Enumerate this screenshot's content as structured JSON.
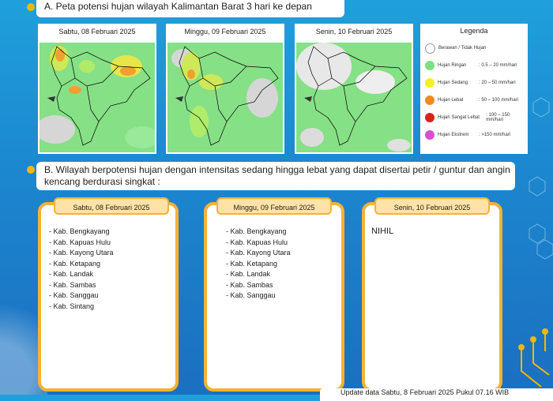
{
  "section_a": {
    "title": "A. Peta potensi hujan wilayah Kalimantan Barat 3 hari ke depan"
  },
  "maps": [
    {
      "date": "Sabtu, 08 Februari 2025"
    },
    {
      "date": "Minggu, 09 Februari 2025"
    },
    {
      "date": "Senin, 10 Februari 2025"
    }
  ],
  "legend": {
    "title": "Legenda",
    "items": [
      {
        "name": "Berawan / Tidak Hujan",
        "range": "",
        "color": "#ffffff"
      },
      {
        "name": "Hujan Ringan",
        "range": ": 0.5 – 20 mm/hari",
        "color": "#7ee07e"
      },
      {
        "name": "Hujan Sedang",
        "range": ": 20 – 50 mm/hari",
        "color": "#f4f21c"
      },
      {
        "name": "Hujan Lebat",
        "range": ": 50 – 100 mm/hari",
        "color": "#f08a24"
      },
      {
        "name": "Hujan Sangat Lebat",
        "range": ": 100 – 150 mm/hari",
        "color": "#e0201c"
      },
      {
        "name": "Hujan Ekstrem",
        "range": ": >150 mm/hari",
        "color": "#d94fd0"
      }
    ]
  },
  "section_b": {
    "title": "B. Wilayah berpotensi hujan dengan intensitas sedang hingga lebat yang dapat disertai petir / guntur dan angin kencang berdurasi singkat :"
  },
  "days": [
    {
      "date": "Sabtu, 08 Februari 2025",
      "regions": [
        "- Kab. Bengkayang",
        "- Kab. Kapuas Hulu",
        "- Kab. Kayong Utara",
        "- Kab. Ketapang",
        "- Kab. Landak",
        "- Kab. Sambas",
        "- Kab. Sanggau",
        "- Kab. Sintang"
      ]
    },
    {
      "date": "Minggu, 09 Februari 2025",
      "regions": [
        "- Kab. Bengkayang",
        "- Kab. Kapuas Hulu",
        "- Kab. Kayong Utara",
        "- Kab. Ketapang",
        "- Kab. Landak",
        "- Kab. Sambas",
        "- Kab. Sanggau"
      ]
    },
    {
      "date": "Senin, 10 Februari 2025",
      "text": "NIHIL"
    }
  ],
  "update_text": "Update data Sabtu, 8 Februari 2025 Pukul 07.16 WIB"
}
